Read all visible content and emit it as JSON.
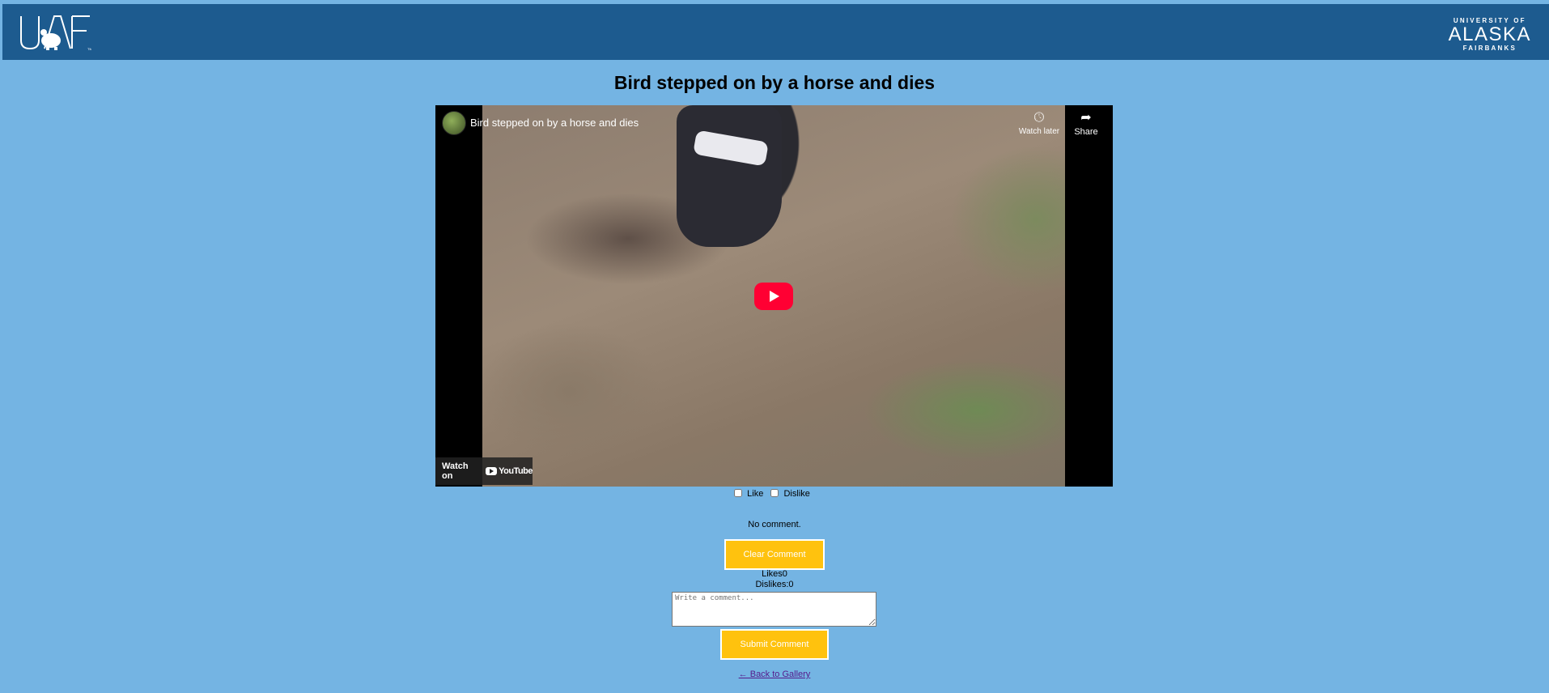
{
  "header": {
    "left_logo_text": "UAF",
    "right_logo": {
      "line1": "UNIVERSITY OF",
      "line2": "ALASKA",
      "line3": "FAIRBANKS"
    }
  },
  "page": {
    "title": "Bird stepped on by a horse and dies"
  },
  "video": {
    "title": "Bird stepped on by a horse and dies",
    "watch_later_label": "Watch later",
    "share_label": "Share",
    "watch_on_label": "Watch on",
    "youtube_label": "YouTube"
  },
  "reactions": {
    "like_label": "Like",
    "dislike_label": "Dislike"
  },
  "comment": {
    "current": "No comment.",
    "clear_label": "Clear Comment",
    "likes_text": "Likes0",
    "dislikes_text": "Dislikes:0",
    "placeholder": "Write a comment...",
    "submit_label": "Submit Comment"
  },
  "nav": {
    "back_label": "← Back to Gallery"
  },
  "colors": {
    "page_bg": "#74b4e3",
    "header_bg": "#1d5b8f",
    "button_bg": "#ffc20e",
    "play_red": "#ff0033"
  }
}
